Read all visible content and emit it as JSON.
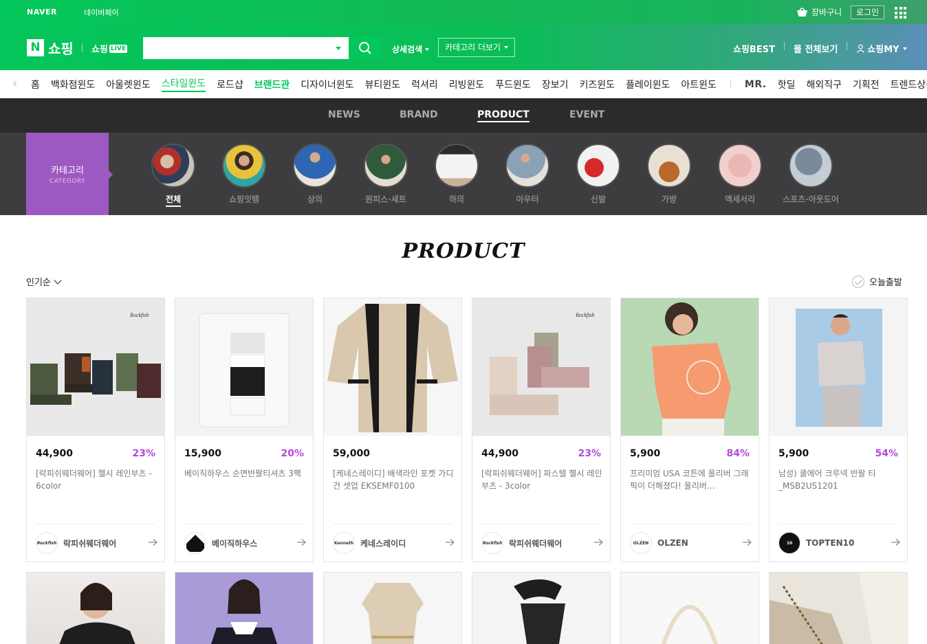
{
  "top": {
    "naver": "NAVER",
    "npay": "네이버페이",
    "cart": "장바구니",
    "login": "로그인"
  },
  "header": {
    "logo_n": "N",
    "title": "쇼핑",
    "live_prefix": "쇼핑",
    "live_badge": "LIVE",
    "search_placeholder": "",
    "detail_search": "상세검색",
    "category_more": "카테고리 더보기",
    "links": [
      "쇼핑BEST",
      "몰 전체보기",
      "쇼핑MY"
    ]
  },
  "category_nav": {
    "items": [
      "홈",
      "백화점윈도",
      "아울렛윈도",
      "스타일윈도",
      "로드샵",
      "브랜드관",
      "디자이너윈도",
      "뷰티윈도",
      "럭셔리",
      "리빙윈도",
      "푸드윈도",
      "장보기",
      "키즈윈도",
      "플레이윈도",
      "아트윈도"
    ],
    "items2": [
      "MR.",
      "핫딜",
      "해외직구",
      "기획전",
      "트렌드상품"
    ]
  },
  "sub_nav": [
    "NEWS",
    "BRAND",
    "PRODUCT",
    "EVENT"
  ],
  "category_strip": {
    "label_ko": "카테고리",
    "label_en": "CATEGORY",
    "items": [
      "전체",
      "쇼핑잇템",
      "상의",
      "원피스·세트",
      "하의",
      "아우터",
      "신발",
      "가방",
      "액세서리",
      "스포츠·아웃도어"
    ]
  },
  "product": {
    "heading": "PRODUCT",
    "sort": "인기순",
    "today": "오늘출발",
    "cards": [
      {
        "price": "44,900",
        "discount": "23%",
        "name": "[락피쉬웨더웨어] 헬시 레인부츠 - 6color",
        "brand": "락피쉬웨더웨어"
      },
      {
        "price": "15,900",
        "discount": "20%",
        "name": "베이직하우스 순면반팔티셔츠 3팩",
        "brand": "베이직하우스"
      },
      {
        "price": "59,000",
        "discount": "",
        "name": "[케네스레이디] 배색라인 포켓 가디건 셋업 EKSEMF0100",
        "brand": "케네스레이디"
      },
      {
        "price": "44,900",
        "discount": "23%",
        "name": "[락피쉬웨더웨어] 파스텔 첼시 레인부츠 - 3color",
        "brand": "락피쉬웨더웨어"
      },
      {
        "price": "5,900",
        "discount": "84%",
        "name": "프리미엄 USA 코튼에 올리버 그래픽이 더해졌다! 올리버…",
        "brand": "OLZEN"
      },
      {
        "price": "5,900",
        "discount": "54%",
        "name": "남성) 쿨에어 크루넥 반팔 티 _MSB2US1201",
        "brand": "TOPTEN10"
      }
    ]
  },
  "colors": {
    "brand_green": "#03c75a",
    "discount_purple": "#b14ad8",
    "category_purple": "#9d59c2"
  }
}
